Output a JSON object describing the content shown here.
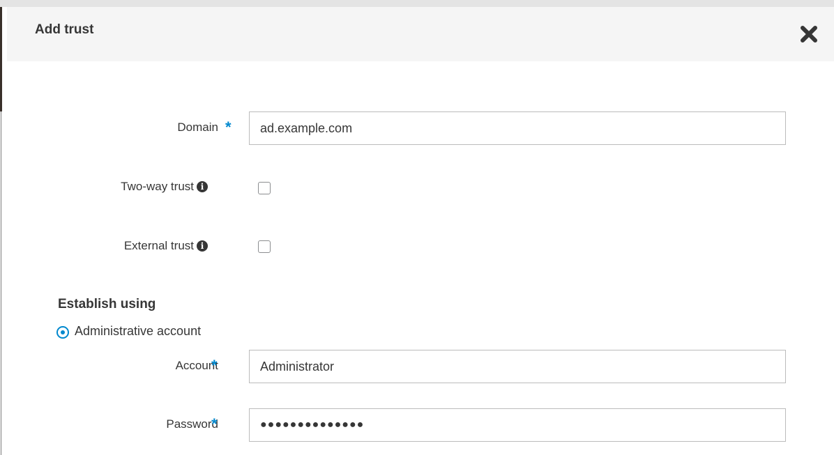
{
  "dialog": {
    "title": "Add trust",
    "close_icon": "close-icon"
  },
  "form": {
    "domain": {
      "label": "Domain",
      "required_marker": "*",
      "value": "ad.example.com"
    },
    "two_way_trust": {
      "label": "Two-way trust",
      "info_icon": "info-icon",
      "checked": false
    },
    "external_trust": {
      "label": "External trust",
      "info_icon": "info-icon",
      "checked": false
    },
    "establish_using": {
      "title": "Establish using",
      "selected_option": "Administrative account"
    },
    "account": {
      "label": "Account",
      "required_marker": "*",
      "value": "Administrator"
    },
    "password": {
      "label": "Password",
      "required_marker": "*",
      "masked_value": "●●●●●●●●●●●●●●"
    }
  },
  "colors": {
    "accent": "#0088ce",
    "header_bg": "#f5f5f5",
    "text": "#363636",
    "border": "#bbbbbb"
  }
}
